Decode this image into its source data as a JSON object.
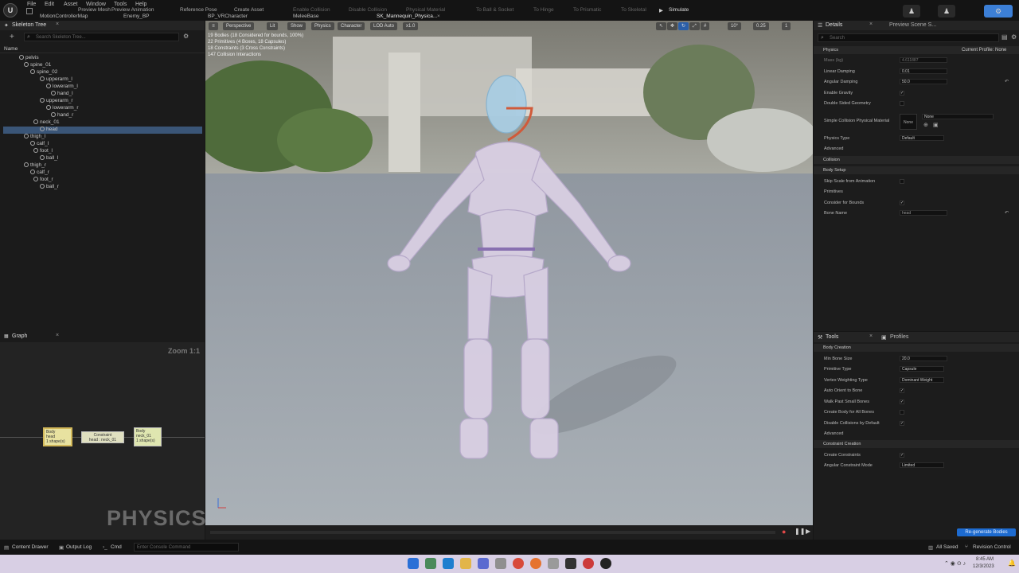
{
  "menu": {
    "file": "File",
    "edit": "Edit",
    "asset": "Asset",
    "window": "Window",
    "tools": "Tools",
    "help": "Help"
  },
  "toolbar": {
    "preview_mesh": "Preview Mesh",
    "preview_animation": "Preview Animation",
    "reference_pose": "Reference Pose",
    "create_asset": "Create Asset",
    "enable_collision": "Enable Collision",
    "disable_collision": "Disable Collision",
    "physical_material": "Physical Material",
    "to_ball_socket": "To Ball & Socket",
    "to_hinge": "To Hinge",
    "to_prismatic": "To Prismatic",
    "to_skeletal": "To Skeletal",
    "simulate": "Simulate"
  },
  "tabs": {
    "motion_map": "MotionControllerMap",
    "enemy_bp": "Enemy_BP",
    "bp_vr": "BP_VRCharacter",
    "melee": "MeleeBase",
    "mannequin": "SK_Mannequin_Physica..."
  },
  "skeleton": {
    "title": "Skeleton Tree",
    "search_placeholder": "Search Skeleton Tree...",
    "column_name": "Name",
    "bones": [
      "pelvis",
      "spine_01",
      "spine_02",
      "upperarm_l",
      "lowerarm_l",
      "hand_l",
      "upperarm_r",
      "lowerarm_r",
      "hand_r",
      "neck_01",
      "head",
      "thigh_l",
      "calf_l",
      "foot_l",
      "ball_l",
      "thigh_r",
      "calf_r",
      "foot_r",
      "ball_r"
    ]
  },
  "graph": {
    "title": "Graph",
    "zoom": "Zoom 1:1",
    "watermark": "PHYSICS",
    "node_body_head": "Body\nhead\n1 shape(s)",
    "node_constraint": "Constraint\nhead : neck_01",
    "node_body_neck": "Body\nneck_01\n1 shape(s)"
  },
  "viewport": {
    "perspective": "Perspective",
    "lit": "Lit",
    "show": "Show",
    "physics": "Physics",
    "character": "Character",
    "lod": "LOD Auto",
    "speed": "x1.0",
    "fov": "10°",
    "scale": "0.25",
    "cam": "1",
    "stats": [
      "19 Bodies (18 Considered for bounds, 100%)",
      "22 Primitives (4 Boxes, 18 Capsules)",
      "18 Constraints (3 Cross Constraints)",
      "147 Collision Interactions"
    ]
  },
  "details": {
    "title": "Details",
    "preview_scene": "Preview Scene S...",
    "search_placeholder": "Search",
    "section_physics": "Physics",
    "current_profile": "Current Profile: None",
    "mass_label": "Mass (kg)",
    "mass_value": "4.611887",
    "linear_damping_label": "Linear Damping",
    "linear_damping_value": "0.01",
    "angular_damping_label": "Angular Damping",
    "angular_damping_value": "50.0",
    "enable_gravity_label": "Enable Gravity",
    "double_sided_label": "Double Sided Geometry",
    "simple_collision_label": "Simple Collision Physical Material",
    "simple_collision_value": "None",
    "simple_collision_thumb": "None",
    "physics_type_label": "Physics Type",
    "physics_type_value": "Default",
    "advanced": "Advanced",
    "collision": "Collision",
    "body_setup": "Body Setup",
    "skip_scale_label": "Skip Scale from Animation",
    "primitives": "Primitives",
    "consider_bounds_label": "Consider for Bounds",
    "bone_name_label": "Bone Name",
    "bone_name_value": "head"
  },
  "tools": {
    "title": "Tools",
    "profiles": "Profiles",
    "body_creation": "Body Creation",
    "min_bone_size_label": "Min Bone Size",
    "min_bone_size_value": "20.0",
    "primitive_type_label": "Primitive Type",
    "primitive_type_value": "Capsule",
    "vertex_weighting_label": "Vertex Weighting Type",
    "vertex_weighting_value": "Dominant Weight",
    "auto_orient_label": "Auto Orient to Bone",
    "walk_past_label": "Walk Past Small Bones",
    "create_body_label": "Create Body for All Bones",
    "disable_collisions_label": "Disable Collisions by Default",
    "advanced": "Advanced",
    "constraint_creation": "Constraint Creation",
    "create_constraints_label": "Create Constraints",
    "angular_mode_label": "Angular Constraint Mode",
    "angular_mode_value": "Limited",
    "regenerate": "Re-generate Bodies"
  },
  "bottom": {
    "content_drawer": "Content Drawer",
    "output_log": "Output Log",
    "cmd": "Cmd",
    "console_placeholder": "Enter Console Command",
    "all_saved": "All Saved",
    "revision_control": "Revision Control"
  },
  "taskbar": {
    "time": "8:45 AM",
    "date": "12/3/2023"
  },
  "colors": {
    "accent": "#1a6fd6",
    "selected_row": "#3a5577",
    "regenerate": "#1d6bd0",
    "node_body": "#e8e2a0",
    "node_constraint": "#e0e0c0"
  }
}
